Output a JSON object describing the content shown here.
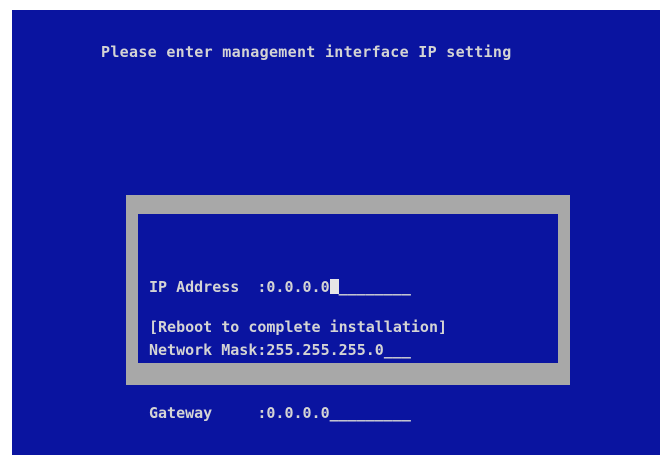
{
  "screen": {
    "title": "Please enter management interface IP setting"
  },
  "form": {
    "ip_address_label": "IP Address  ",
    "ip_address_sep": ":",
    "ip_address_value": "0.0.0.0",
    "ip_address_blanks": "________",
    "network_mask_label": "Network Mask",
    "network_mask_sep": ":",
    "network_mask_value": "255.255.255.0",
    "network_mask_blanks": "___",
    "gateway_label": "Gateway     ",
    "gateway_sep": ":",
    "gateway_value": "0.0.0.0",
    "gateway_blanks": "_________"
  },
  "footer": {
    "reboot_text": "[Reboot to complete installation]"
  },
  "colors": {
    "background": "#0a14a0",
    "frame": "#a8a8a8",
    "text": "#d4d4d4"
  }
}
